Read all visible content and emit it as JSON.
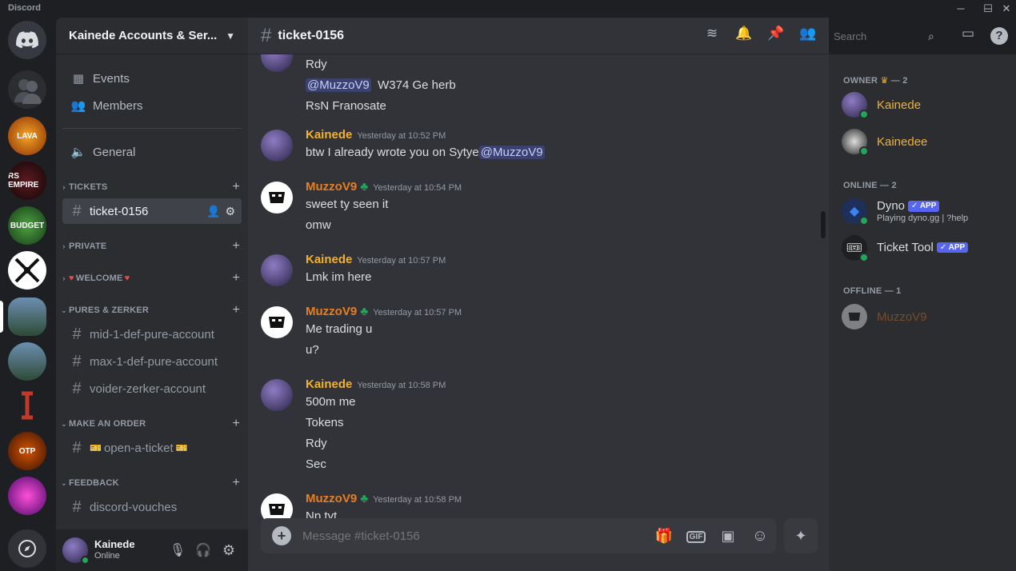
{
  "window": {
    "title": "Discord",
    "controls": [
      "─",
      "☐",
      "✕"
    ]
  },
  "guilds": [
    {
      "label": "",
      "color": "#5865f2"
    },
    {
      "label": "",
      "color": "#4e5058"
    },
    {
      "label": "LAVA",
      "color": "#b5530f"
    },
    {
      "label": "RS EMPIRE",
      "color": "#2c0f12"
    },
    {
      "label": "BUDGET",
      "color": "#2f6b2a"
    },
    {
      "label": "",
      "color": "#ffffff"
    },
    {
      "label": "",
      "color": "#3a5a7a"
    },
    {
      "label": "",
      "color": "#3a5a7a"
    },
    {
      "label": "",
      "color": "#1e1f22"
    },
    {
      "label": "OTP",
      "color": "#7a2a12"
    },
    {
      "label": "",
      "color": "#c2187a"
    }
  ],
  "server": {
    "name": "Kainede Accounts & Ser..."
  },
  "sidebar": {
    "events": "Events",
    "members": "Members",
    "general": "General",
    "categories": {
      "tickets": "TICKETS",
      "private": "PRIVATE",
      "welcome": "WELCOME",
      "pures": "PURES & ZERKER",
      "order": "MAKE AN ORDER",
      "feedback": "FEEDBACK"
    },
    "channels": {
      "ticket": "ticket-0156",
      "mid": "mid-1-def-pure-account",
      "max": "max-1-def-pure-account",
      "voider": "voider-zerker-account",
      "open": "open-a-ticket",
      "vouches": "discord-vouches"
    }
  },
  "user": {
    "name": "Kainede",
    "status": "Online"
  },
  "channel": {
    "name": "ticket-0156"
  },
  "search": {
    "placeholder": "Search"
  },
  "messages": {
    "top": {
      "l1": "Rdy",
      "mention": "@MuzzoV9",
      "l2rest": "W374 Ge herb",
      "l3": "RsN Franosate"
    },
    "m1": {
      "author": "Kainede",
      "time": "Yesterday at 10:52 PM",
      "text": "btw I already wrote you on Sytye",
      "mention": "@MuzzoV9"
    },
    "m2": {
      "author": "MuzzoV9",
      "time": "Yesterday at 10:54 PM",
      "l1": "sweet ty seen it",
      "l2": "omw"
    },
    "m3": {
      "author": "Kainede",
      "time": "Yesterday at 10:57 PM",
      "l1": "Lmk im here"
    },
    "m4": {
      "author": "MuzzoV9",
      "time": "Yesterday at 10:57 PM",
      "l1": "Me trading u",
      "l2": "u?"
    },
    "m5": {
      "author": "Kainede",
      "time": "Yesterday at 10:58 PM",
      "l1": "500m me",
      "l2": "Tokens",
      "l3": "Rdy",
      "l4": "Sec"
    },
    "m6": {
      "author": "MuzzoV9",
      "time": "Yesterday at 10:58 PM",
      "l1": "Np tyt"
    }
  },
  "composer": {
    "placeholder": "Message #ticket-0156",
    "gif": "GIF"
  },
  "members": {
    "owner_group": "OWNER",
    "owner_count": "— 2",
    "kainede": "Kainede",
    "kainedee": "Kainedee",
    "online_group": "ONLINE — 2",
    "dyno": "Dyno",
    "dyno_status": "Playing dyno.gg | ?help",
    "ticket_tool": "Ticket Tool",
    "app_tag": "✓ APP",
    "offline_group": "OFFLINE — 1",
    "muzzo": "MuzzoV9"
  },
  "colors": {
    "kainede": "#f0b232",
    "muzzo": "#e67e22",
    "online": "#23a55a"
  }
}
